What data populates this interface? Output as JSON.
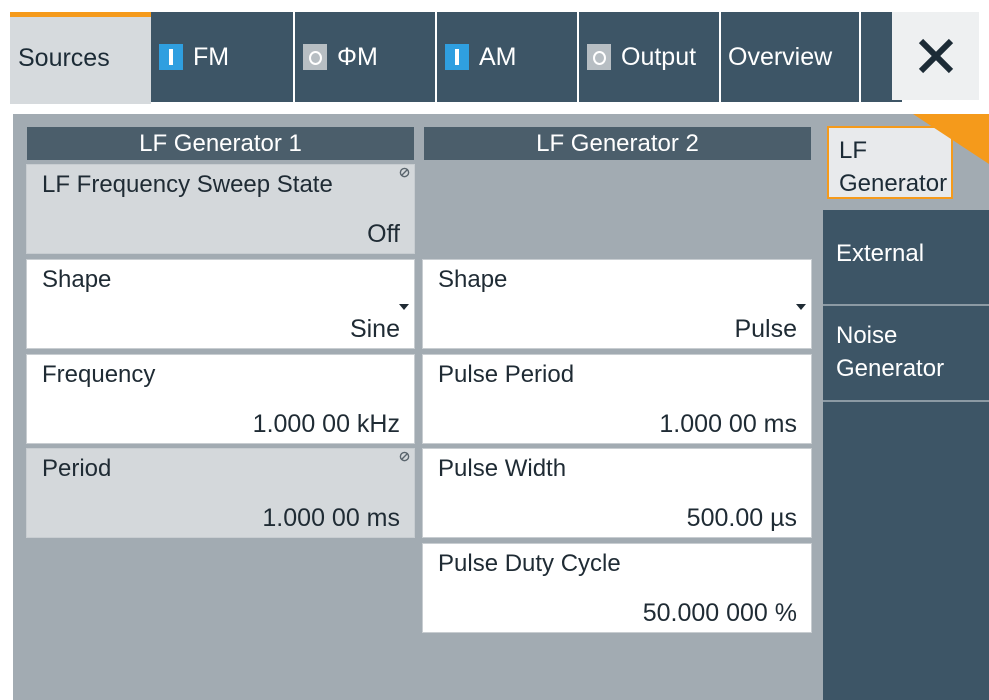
{
  "tabs": {
    "sources": "Sources",
    "fm": "FM",
    "phim": "ΦM",
    "am": "AM",
    "output": "Output",
    "overview": "Overview"
  },
  "indicators": {
    "fm": "on",
    "phim": "off",
    "am": "on",
    "output": "off"
  },
  "gen1": {
    "title": "LF Generator 1",
    "sweep_state": {
      "label": "LF Frequency Sweep State",
      "value": "Off"
    },
    "shape": {
      "label": "Shape",
      "value": "Sine"
    },
    "frequency": {
      "label": "Frequency",
      "value": "1.000 00 kHz"
    },
    "period": {
      "label": "Period",
      "value": "1.000 00 ms"
    }
  },
  "gen2": {
    "title": "LF Generator 2",
    "shape": {
      "label": "Shape",
      "value": "Pulse"
    },
    "pulse_period": {
      "label": "Pulse Period",
      "value": "1.000 00 ms"
    },
    "pulse_width": {
      "label": "Pulse Width",
      "value": "500.00 µs"
    },
    "pulse_duty": {
      "label": "Pulse Duty Cycle",
      "value": "50.000 000 %"
    }
  },
  "sidebar": {
    "lf_generator_l1": "LF",
    "lf_generator_l2": "Generator",
    "external": "External",
    "noise_l1": "Noise",
    "noise_l2": "Generator"
  },
  "colors": {
    "accent": "#f59a1b",
    "tab_dark": "#3d5566",
    "indicator_on": "#2f9fe0"
  }
}
